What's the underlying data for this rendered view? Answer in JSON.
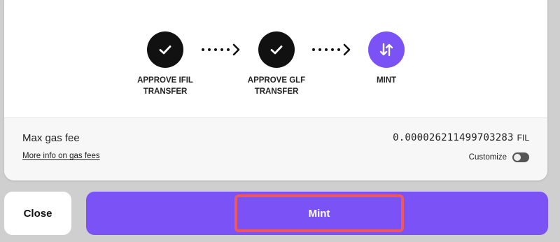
{
  "steps": [
    {
      "label": "APPROVE IFIL\nTRANSFER",
      "status": "complete",
      "icon": "check-icon"
    },
    {
      "label": "APPROVE GLF\nTRANSFER",
      "status": "complete",
      "icon": "check-icon"
    },
    {
      "label": "MINT",
      "status": "current",
      "icon": "swap-arrows-icon"
    }
  ],
  "gas": {
    "title": "Max gas fee",
    "link": "More info on gas fees",
    "value": "0.000026211499703283",
    "unit": "FIL",
    "customize_label": "Customize",
    "customize_enabled": false
  },
  "actions": {
    "close_label": "Close",
    "mint_label": "Mint"
  },
  "colors": {
    "accent": "#7b52f5",
    "step_done": "#111111",
    "highlight": "#f0575b"
  }
}
